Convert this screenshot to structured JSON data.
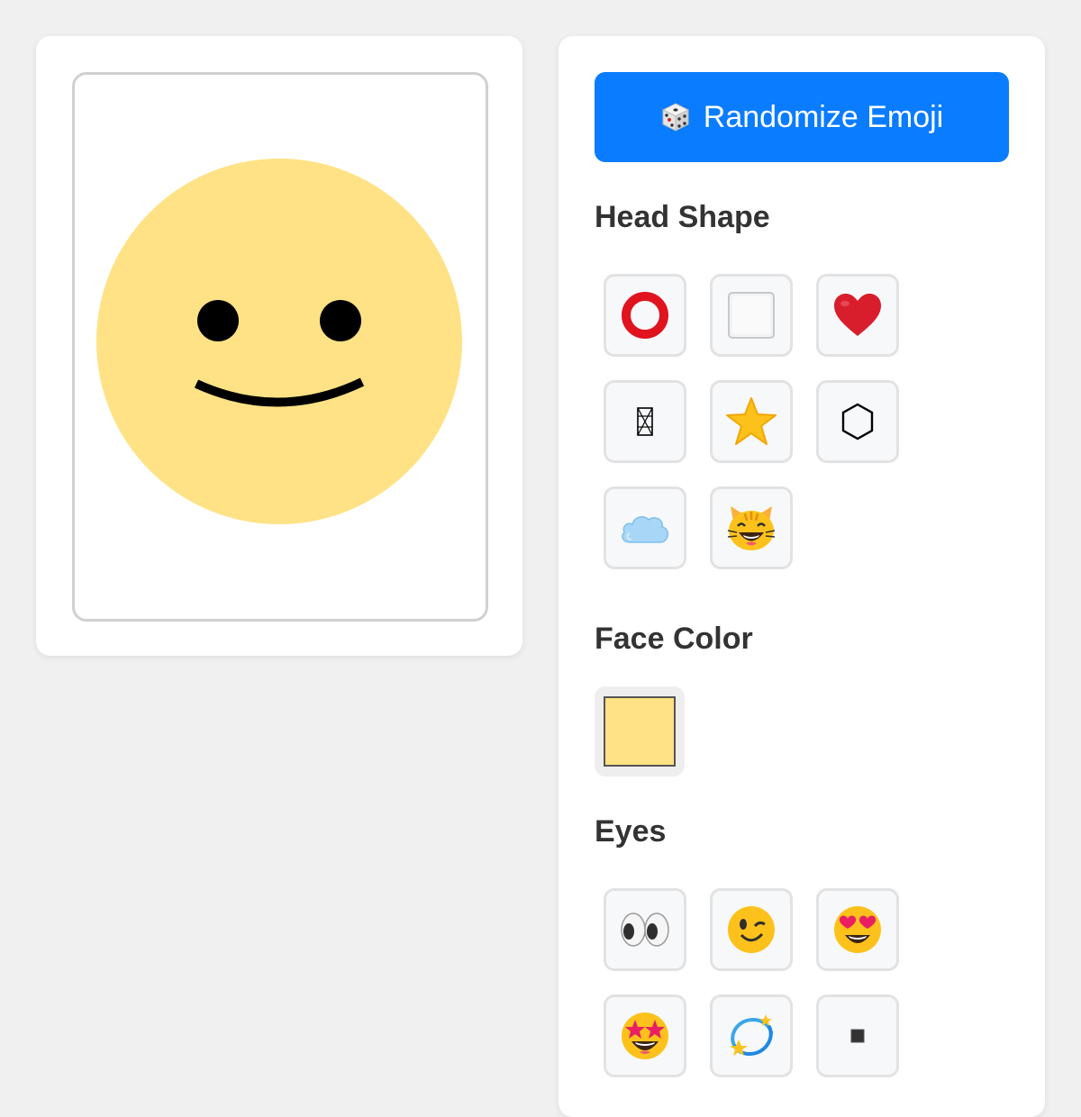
{
  "preview": {
    "face_color": "#FFE285",
    "head_shape": "circle",
    "eyes": "dots",
    "mouth": "smile"
  },
  "randomize_button": {
    "label": "Randomize Emoji",
    "icon": "dice-icon",
    "color": "#0A7CFF"
  },
  "head_shape": {
    "title": "Head Shape",
    "options": [
      {
        "name": "circle",
        "glyph": "⭕"
      },
      {
        "name": "square",
        "glyph": "⬜"
      },
      {
        "name": "heart",
        "glyph": "❤️"
      },
      {
        "name": "tall-rectangle",
        "glyph": ""
      },
      {
        "name": "star",
        "glyph": "⭐"
      },
      {
        "name": "hexagon",
        "glyph": "⬡"
      },
      {
        "name": "cloud",
        "glyph": "☁️"
      },
      {
        "name": "cat",
        "glyph": "😸"
      }
    ]
  },
  "face_color": {
    "title": "Face Color",
    "swatches": [
      {
        "name": "yellow",
        "color": "#FFE285"
      }
    ]
  },
  "eyes": {
    "title": "Eyes",
    "options": [
      {
        "name": "normal-eyes",
        "glyph": "👀"
      },
      {
        "name": "wink",
        "glyph": "😉"
      },
      {
        "name": "heart-eyes",
        "glyph": "😍"
      },
      {
        "name": "star-eyes",
        "glyph": "🤩"
      },
      {
        "name": "dizzy",
        "glyph": "💫"
      },
      {
        "name": "small-square",
        "glyph": "▪️"
      }
    ]
  }
}
